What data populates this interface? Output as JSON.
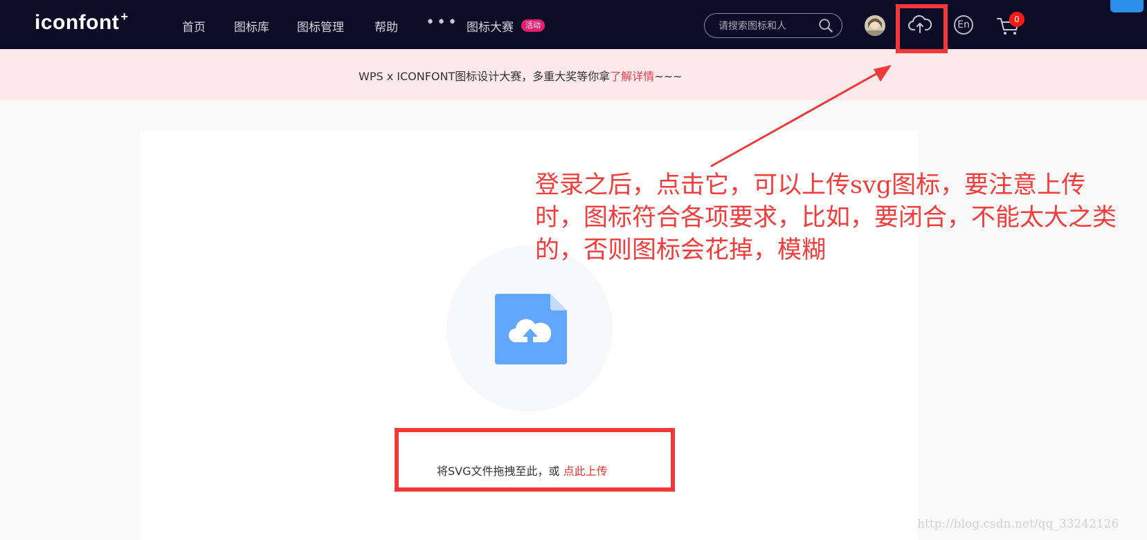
{
  "brand": {
    "logo_text": "iconfont",
    "logo_plus": "+"
  },
  "nav": {
    "items": [
      "首页",
      "图标库",
      "图标管理",
      "帮助"
    ],
    "more": "•••",
    "contest_label": "图标大赛",
    "contest_badge": "活动"
  },
  "search": {
    "placeholder": "请搜索图标和人"
  },
  "header_actions": {
    "lang_label": "En",
    "cart_count": "0"
  },
  "announcement": {
    "text": "WPS x ICONFONT图标设计大赛，多重大奖等你拿",
    "link_text": "了解详情",
    "suffix": "~~~"
  },
  "upload": {
    "hint": "将SVG文件拖拽至此，或 ",
    "link_text": "点此上传"
  },
  "annotation": {
    "text": "登录之后，点击它，可以上传svg图标，要注意上传时，图标符合各项要求，比如，要闭合，不能太大之类的，否则图标会花掉，模糊"
  },
  "watermark": {
    "text": "http://blog.csdn.net/qq_33242126"
  },
  "colors": {
    "nav_bg": "#0c0c26",
    "announcement_bg": "#fde9ea",
    "link_red": "#ef3c4d",
    "annotation_red": "#f23838",
    "upload_blue": "#62a7ff"
  }
}
